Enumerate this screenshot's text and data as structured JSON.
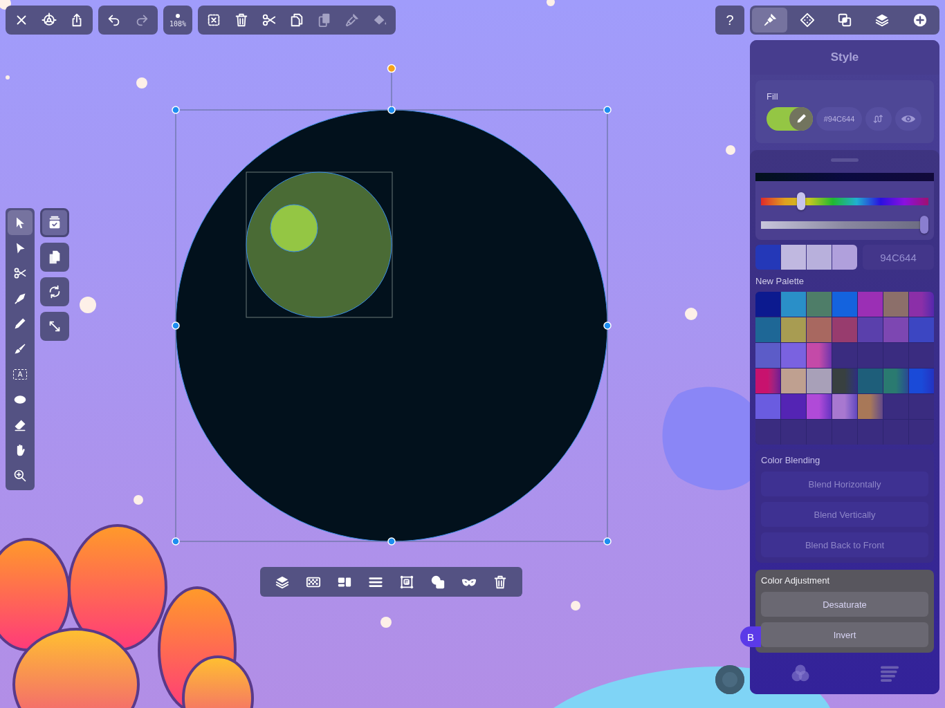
{
  "toolbar_groups": [
    {
      "kind": "buttons",
      "items": [
        {
          "kind": "close",
          "disabled": false
        },
        {
          "kind": "settings",
          "disabled": false
        },
        {
          "kind": "share",
          "disabled": false
        }
      ]
    },
    {
      "kind": "buttons",
      "items": [
        {
          "kind": "undo",
          "disabled": false
        },
        {
          "kind": "redo",
          "disabled": true
        }
      ]
    },
    {
      "kind": "zoom",
      "label": "108%"
    },
    {
      "kind": "buttons",
      "items": [
        {
          "kind": "deselect",
          "disabled": false
        },
        {
          "kind": "trash",
          "disabled": false
        },
        {
          "kind": "cut",
          "disabled": false
        },
        {
          "kind": "copy",
          "disabled": false
        },
        {
          "kind": "paste",
          "disabled": true
        },
        {
          "kind": "copy_style",
          "disabled": true
        },
        {
          "kind": "bucket",
          "disabled": true
        }
      ]
    }
  ],
  "help": {
    "label": "?"
  },
  "panel_tabs": [
    {
      "kind": "style",
      "selected": true
    },
    {
      "kind": "node",
      "selected": false
    },
    {
      "kind": "boolean",
      "selected": false
    },
    {
      "kind": "layers",
      "selected": false
    },
    {
      "kind": "add",
      "selected": false
    }
  ],
  "style_panel": {
    "title": "Style",
    "fill": {
      "label": "Fill",
      "on": true,
      "color": "#94c644",
      "hex": "#94C644"
    },
    "picker": {
      "hue": {
        "level": 0.24
      },
      "alpha": {
        "level": 1
      },
      "recent": [
        {
          "color": "#2438b8"
        },
        {
          "color": "#c0b8e0"
        },
        {
          "color": "#b8b0dc"
        },
        {
          "color": "#b0a0dc"
        }
      ],
      "hex": "94C644",
      "palette_title": "New Palette",
      "palette": [
        {
          "kind": "solid",
          "color": "#0c1a8f"
        },
        {
          "kind": "solid",
          "color": "#2a8fc8"
        },
        {
          "kind": "solid",
          "color": "#4e7d68"
        },
        {
          "kind": "solid",
          "color": "#1463de"
        },
        {
          "kind": "solid",
          "color": "#9b2fb5"
        },
        {
          "kind": "solid",
          "color": "#8c6f6a"
        },
        {
          "kind": "gradient",
          "color": "#8b2fa8"
        },
        {
          "kind": "solid",
          "color": "#1e6796"
        },
        {
          "kind": "solid",
          "color": "#a89c52"
        },
        {
          "kind": "solid",
          "color": "#a86860"
        },
        {
          "kind": "solid",
          "color": "#983c6e"
        },
        {
          "kind": "solid",
          "color": "#5a40ac"
        },
        {
          "kind": "solid",
          "color": "#7d47b2"
        },
        {
          "kind": "solid",
          "color": "#3c46c2"
        },
        {
          "kind": "solid",
          "color": "#5c5cc8"
        },
        {
          "kind": "solid",
          "color": "#7a62e0"
        },
        {
          "kind": "gradient",
          "color": "#c44aa8"
        },
        {
          "kind": "empty"
        },
        {
          "kind": "empty"
        },
        {
          "kind": "empty"
        },
        {
          "kind": "empty"
        },
        {
          "kind": "gradient",
          "color": "#c8126e"
        },
        {
          "kind": "solid",
          "color": "#bfa090"
        },
        {
          "kind": "solid",
          "color": "#a8a0b8"
        },
        {
          "kind": "gradient",
          "color": "#384040"
        },
        {
          "kind": "solid",
          "color": "#1e5e7a"
        },
        {
          "kind": "gradient",
          "color": "#2a7a70"
        },
        {
          "kind": "gradient",
          "color": "#1a4ad8"
        },
        {
          "kind": "solid",
          "color": "#6a5ce0"
        },
        {
          "kind": "solid",
          "color": "#5424b4"
        },
        {
          "kind": "gradient",
          "color": "#b04ad8"
        },
        {
          "kind": "gradient",
          "color": "#a878d0"
        },
        {
          "kind": "gradient",
          "color": "#a87858"
        },
        {
          "kind": "empty"
        },
        {
          "kind": "empty"
        },
        {
          "kind": "empty"
        },
        {
          "kind": "empty"
        },
        {
          "kind": "empty"
        },
        {
          "kind": "empty"
        },
        {
          "kind": "empty"
        },
        {
          "kind": "empty"
        },
        {
          "kind": "empty"
        }
      ]
    },
    "blending": {
      "title": "Color Blending",
      "buttons": [
        {
          "label": "Blend Horizontally",
          "disabled": true
        },
        {
          "label": "Blend Vertically",
          "disabled": true
        },
        {
          "label": "Blend Back to Front",
          "disabled": true
        }
      ]
    },
    "adjustment": {
      "title": "Color Adjustment",
      "buttons": [
        {
          "label": "Desaturate",
          "disabled": false
        },
        {
          "label": "Invert",
          "disabled": false
        }
      ]
    },
    "badge": "B",
    "bottom_tabs": [
      {
        "kind": "blend",
        "selected": true
      },
      {
        "kind": "list",
        "selected": false
      }
    ]
  },
  "left_tools": [
    {
      "kind": "select",
      "selected": true
    },
    {
      "kind": "direct",
      "selected": false
    },
    {
      "kind": "cut",
      "selected": false
    },
    {
      "kind": "pen",
      "selected": false
    },
    {
      "kind": "pencil",
      "selected": false
    },
    {
      "kind": "brush",
      "selected": false
    },
    {
      "kind": "text",
      "label": "A",
      "selected": false
    },
    {
      "kind": "ellipse",
      "selected": false
    },
    {
      "kind": "eraser",
      "selected": false
    },
    {
      "kind": "hand",
      "selected": false
    },
    {
      "kind": "zoom",
      "selected": false
    }
  ],
  "side_buttons": [
    {
      "kind": "stack",
      "selected": true
    },
    {
      "kind": "documents",
      "selected": false
    },
    {
      "kind": "refresh",
      "selected": false
    },
    {
      "kind": "resize",
      "selected": false
    }
  ],
  "bottom_toolbar": [
    {
      "kind": "layers"
    },
    {
      "kind": "checker"
    },
    {
      "kind": "tiles"
    },
    {
      "kind": "lines"
    },
    {
      "kind": "frame"
    },
    {
      "kind": "union"
    },
    {
      "kind": "mask"
    },
    {
      "kind": "trash"
    }
  ]
}
